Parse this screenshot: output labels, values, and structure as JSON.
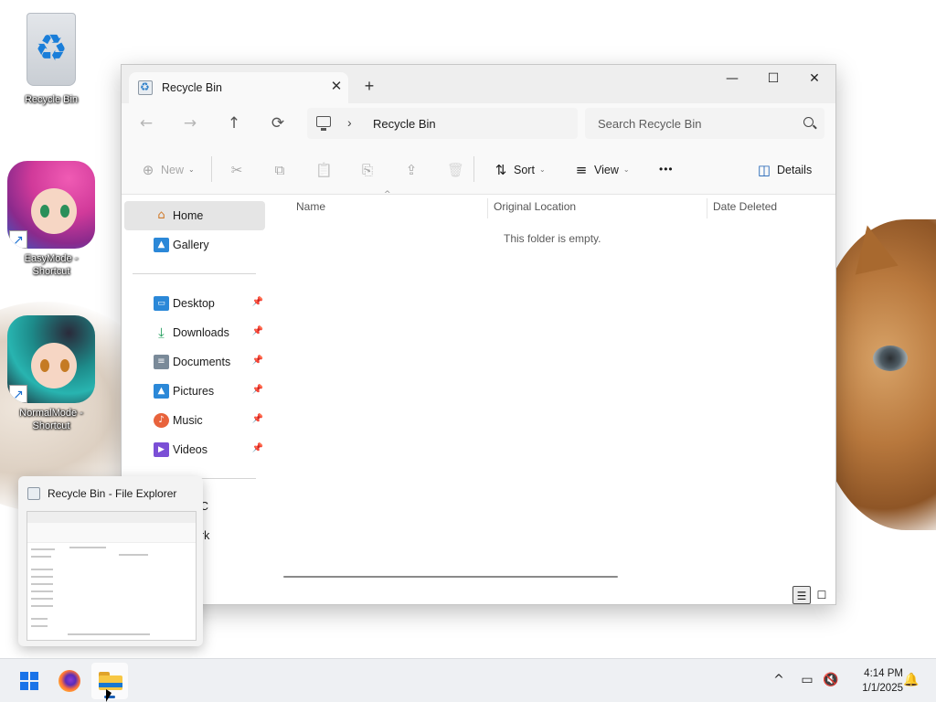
{
  "desktop": {
    "icons": [
      {
        "label": "Recycle Bin",
        "icon": "recycle-bin-icon"
      },
      {
        "label": "EasyMode - Shortcut",
        "icon": "easymode-app-icon"
      },
      {
        "label": "NormalMode - Shortcut",
        "icon": "normalmode-app-icon"
      }
    ]
  },
  "window": {
    "tab_title": "Recycle Bin",
    "new_tab_symbol": "+",
    "close_tab_symbol": "✕",
    "controls": {
      "minimize": "—",
      "maximize": "☐",
      "close": "✕"
    }
  },
  "addressbar": {
    "nav": {
      "back": "←",
      "forward": "→",
      "up": "↑",
      "refresh": "⟳"
    },
    "crumb_separator": "›",
    "breadcrumb": "Recycle Bin",
    "search_placeholder": "Search Recycle Bin"
  },
  "commandbar": {
    "new": {
      "label": "New",
      "icon": "⊕",
      "caret": "⌄"
    },
    "cut_icon": "✂",
    "copy_icon": "⧉",
    "paste_icon": "📋",
    "rename_icon": "⎘",
    "share_icon": "⇪",
    "delete_icon": "🗑",
    "sort": {
      "label": "Sort",
      "icon": "⇅",
      "caret": "⌄"
    },
    "view": {
      "label": "View",
      "icon": "≡",
      "caret": "⌄"
    },
    "more_icon": "•••",
    "details": {
      "label": "Details",
      "icon": "◫"
    }
  },
  "sidebar": {
    "home": "Home",
    "gallery": "Gallery",
    "pinned": [
      {
        "label": "Desktop",
        "icon": "desktop-icon",
        "color": "#2b88d8"
      },
      {
        "label": "Downloads",
        "icon": "downloads-icon",
        "color": "#1e9c5a"
      },
      {
        "label": "Documents",
        "icon": "documents-icon",
        "color": "#7a8a99"
      },
      {
        "label": "Pictures",
        "icon": "pictures-icon",
        "color": "#2b88d8"
      },
      {
        "label": "Music",
        "icon": "music-icon",
        "color": "#e8633c"
      },
      {
        "label": "Videos",
        "icon": "videos-icon",
        "color": "#7b4fd6"
      }
    ],
    "pin_symbol": "📌"
  },
  "content": {
    "columns": [
      "Name",
      "Original Location",
      "Date Deleted"
    ],
    "sort_indicator": "^",
    "empty_message": "This folder is empty."
  },
  "preview": {
    "title": "Recycle Bin - File Explorer"
  },
  "sidebar_peek": {
    "this_pc_fragment": "C",
    "network_fragment": "rk"
  },
  "taskbar": {
    "tray_chevron": "^",
    "network_icon": "network-icon",
    "volume_icon": "volume-muted-icon",
    "time": "4:14 PM",
    "date": "1/1/2025",
    "notification_icon": "bell-icon"
  },
  "colors": {
    "accent": "#1a73e8",
    "window_bg": "#ffffff",
    "chrome_bg": "#f9f9f9",
    "taskbar_bg": "#eef0f3"
  }
}
